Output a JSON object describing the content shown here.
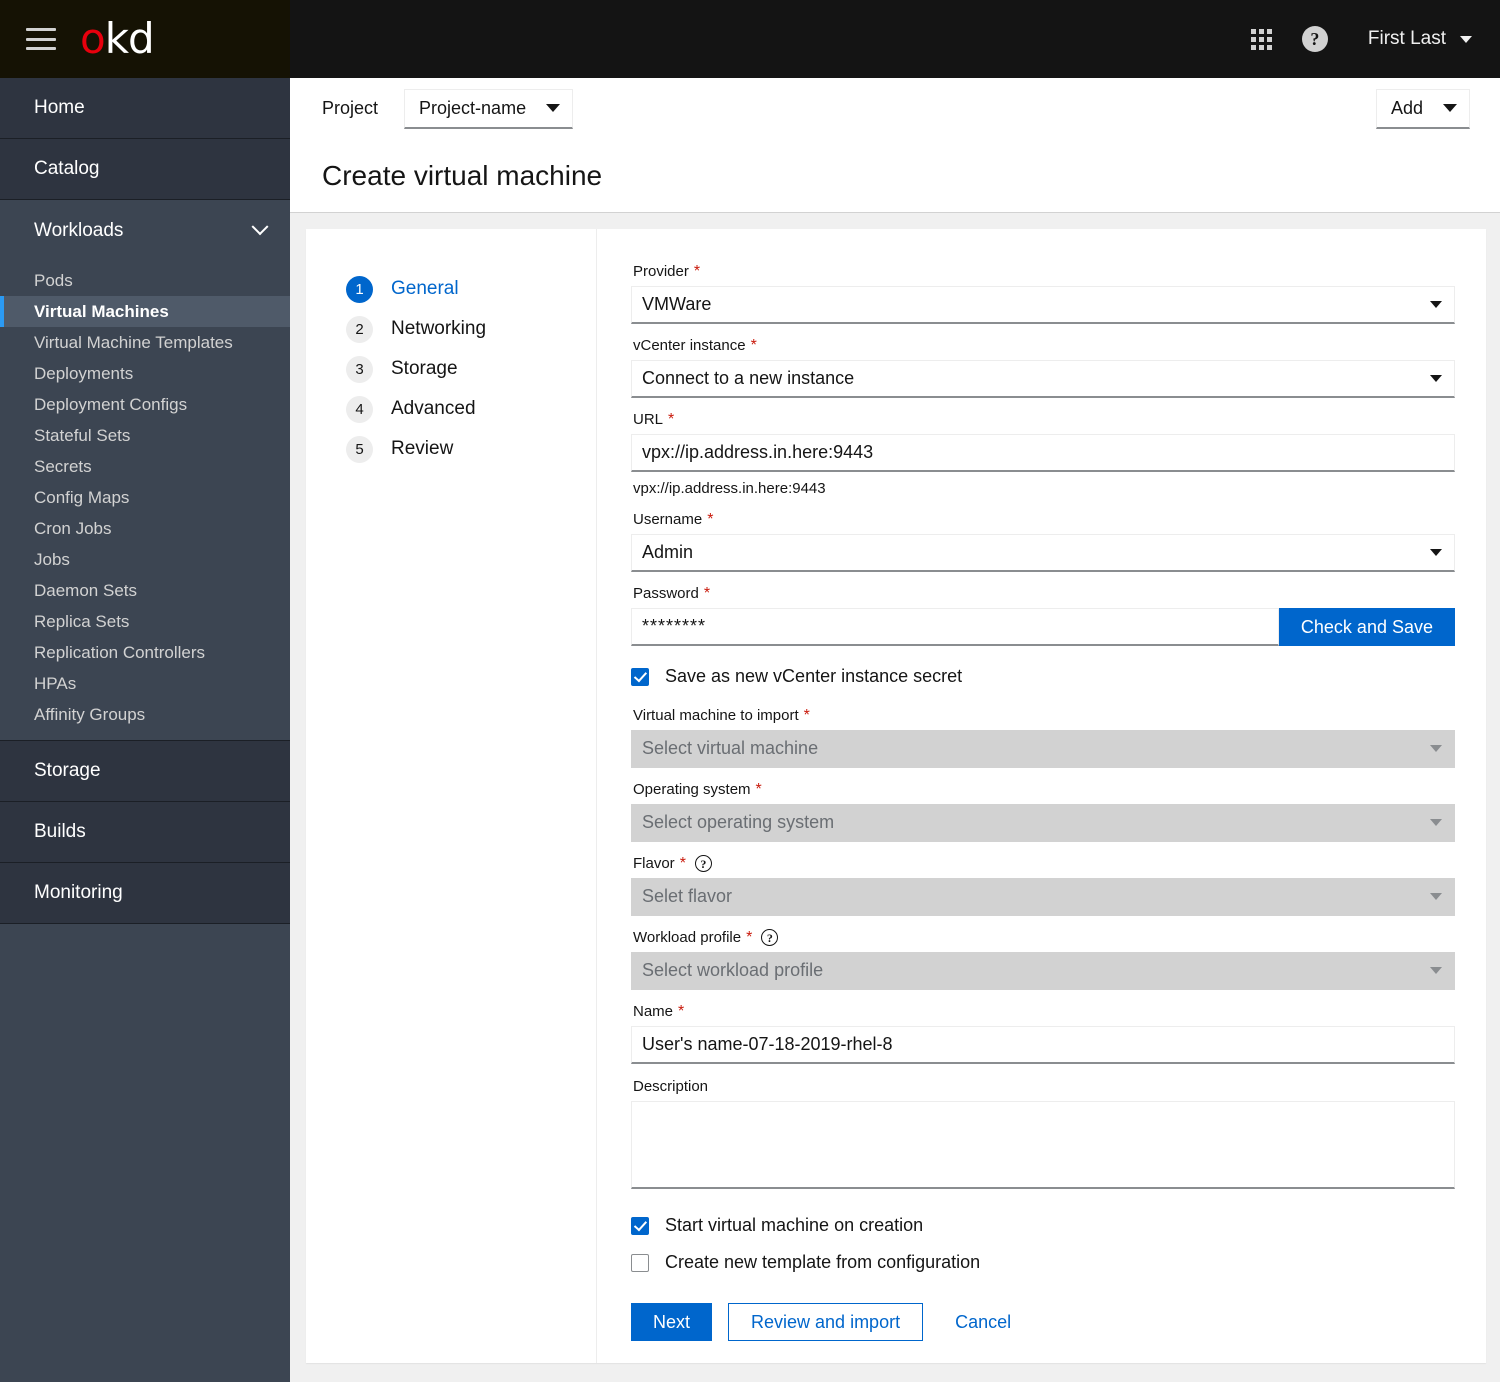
{
  "masthead": {
    "menu_icon": "hamburger-icon",
    "brand": {
      "o": "o",
      "kd": "kd"
    },
    "apps_icon": "grid-apps-icon",
    "help_icon": "help-circle-icon",
    "user_name": "First Last",
    "user_caret_icon": "caret-down-icon"
  },
  "sidebar": {
    "sections": [
      {
        "type": "header",
        "label": "Home",
        "expandable": false
      },
      {
        "type": "header",
        "label": "Catalog",
        "expandable": false
      },
      {
        "type": "header",
        "label": "Workloads",
        "expandable": true,
        "expanded": true
      },
      {
        "type": "header",
        "label": "Storage",
        "expandable": false
      },
      {
        "type": "header",
        "label": "Builds",
        "expandable": false
      },
      {
        "type": "header",
        "label": "Monitoring",
        "expandable": false
      }
    ],
    "workloads_items": [
      {
        "label": "Pods",
        "active": false
      },
      {
        "label": "Virtual Machines",
        "active": true
      },
      {
        "label": "Virtual Machine Templates",
        "active": false
      },
      {
        "label": "Deployments",
        "active": false
      },
      {
        "label": "Deployment Configs",
        "active": false
      },
      {
        "label": "Stateful Sets",
        "active": false
      },
      {
        "label": "Secrets",
        "active": false
      },
      {
        "label": "Config Maps",
        "active": false
      },
      {
        "label": "Cron Jobs",
        "active": false
      },
      {
        "label": "Jobs",
        "active": false
      },
      {
        "label": "Daemon Sets",
        "active": false
      },
      {
        "label": "Replica Sets",
        "active": false
      },
      {
        "label": "Replication Controllers",
        "active": false
      },
      {
        "label": "HPAs",
        "active": false
      },
      {
        "label": "Affinity Groups",
        "active": false
      }
    ]
  },
  "topbar": {
    "project_label": "Project",
    "project_value": "Project-name",
    "add_label": "Add"
  },
  "page": {
    "title": "Create virtual machine"
  },
  "wizard": {
    "steps": [
      {
        "num": "1",
        "label": "General",
        "current": true
      },
      {
        "num": "2",
        "label": "Networking",
        "current": false
      },
      {
        "num": "3",
        "label": "Storage",
        "current": false
      },
      {
        "num": "4",
        "label": "Advanced",
        "current": false
      },
      {
        "num": "5",
        "label": "Review",
        "current": false
      }
    ]
  },
  "form": {
    "provider": {
      "label": "Provider",
      "required": "*",
      "value": "VMWare"
    },
    "vcenter": {
      "label": "vCenter instance",
      "required": "*",
      "value": "Connect to a new instance"
    },
    "url": {
      "label": "URL",
      "required": "*",
      "value": "vpx://ip.address.in.here:9443",
      "helper": "vpx://ip.address.in.here:9443"
    },
    "username": {
      "label": "Username",
      "required": "*",
      "value": "Admin"
    },
    "password": {
      "label": "Password",
      "required": "*",
      "value": "********",
      "button": "Check and Save"
    },
    "save_secret": {
      "label": "Save as new vCenter instance secret",
      "checked": true
    },
    "vm_to_import": {
      "label": "Virtual machine to import",
      "required": "*",
      "placeholder": "Select virtual machine",
      "disabled": true
    },
    "operating_system": {
      "label": "Operating system",
      "required": "*",
      "placeholder": "Select operating system",
      "disabled": true
    },
    "flavor": {
      "label": "Flavor",
      "required": "*",
      "help": "help-circle-icon",
      "placeholder": "Selet flavor",
      "disabled": true
    },
    "workload_profile": {
      "label": "Workload profile",
      "required": "*",
      "help": "help-circle-icon",
      "placeholder": "Select workload profile",
      "disabled": true
    },
    "name": {
      "label": "Name",
      "required": "*",
      "value": "User's name-07-18-2019-rhel-8"
    },
    "description": {
      "label": "Description",
      "value": ""
    },
    "start_vm": {
      "label": "Start virtual machine on creation",
      "checked": true
    },
    "create_template": {
      "label": "Create new template from configuration",
      "checked": false
    }
  },
  "footer": {
    "next": "Next",
    "review_and_import": "Review and import",
    "cancel": "Cancel"
  },
  "colors": {
    "accent_blue": "#0066cc",
    "active_nav_blue": "#2b9af3",
    "required_red": "#c9190b",
    "brand_red": "#e8000d",
    "masthead_black": "#141414",
    "sidebar": "#3c4552"
  }
}
